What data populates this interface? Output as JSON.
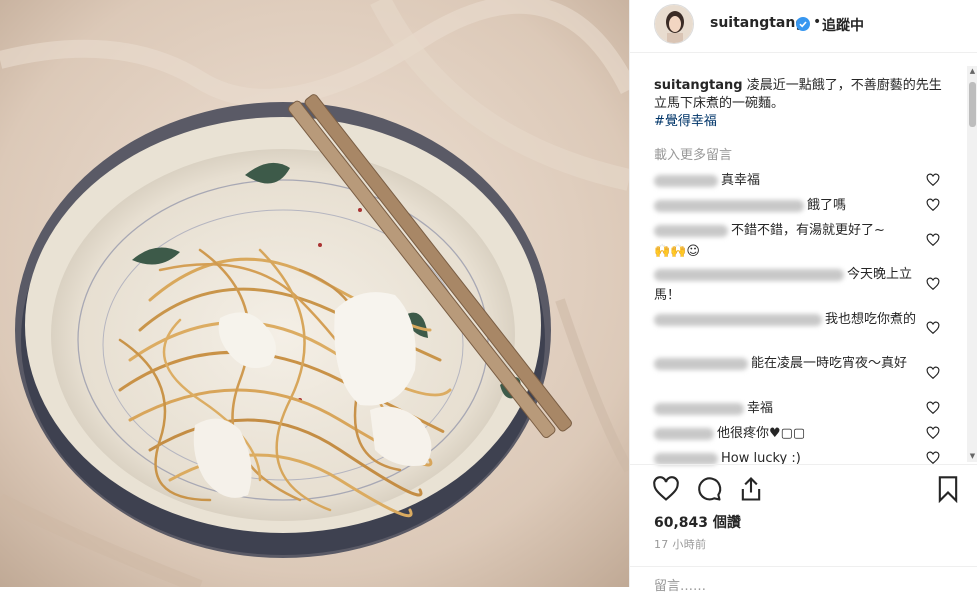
{
  "post": {
    "username": "suitangtang",
    "follow_status": "追蹤中",
    "separator": "•",
    "caption_user": "suitangtang",
    "caption_text": "凌晨近一點餓了，不善廚藝的先生立馬下床煮的一碗麵。",
    "hashtag": "#覺得幸福",
    "load_more": "載入更多留言",
    "likes": "60,843 個讚",
    "time_ago": "17 小時前",
    "add_comment_placeholder": "留言……"
  },
  "comments": [
    {
      "text": "真幸福"
    },
    {
      "text": "餓了嗎"
    },
    {
      "text": "不錯不錯，有湯就更好了~"
    },
    {
      "text": "今天晚上立馬！"
    },
    {
      "text": "我也想吃你煮的"
    },
    {
      "text": "能在凌晨一時吃宵夜～真好"
    },
    {
      "text": "幸福"
    },
    {
      "text": "他很疼你♥▢▢"
    },
    {
      "text": "How lucky :)"
    }
  ],
  "colors": {
    "verified": "#3897f0",
    "hashtag": "#003569",
    "muted": "#999999"
  },
  "icons": [
    "heart-icon",
    "comment-icon",
    "share-icon",
    "bookmark-icon",
    "verified-badge-icon",
    "more-icon"
  ]
}
